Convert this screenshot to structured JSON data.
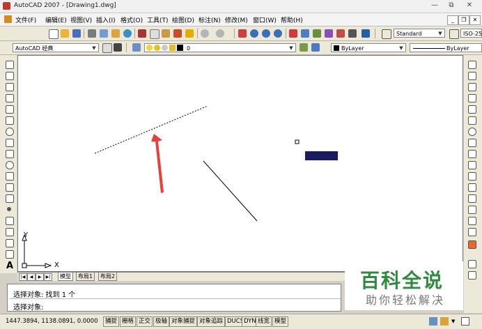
{
  "window": {
    "title": "AutoCAD 2007 - [Drawing1.dwg]",
    "controls": [
      "—",
      "⧉",
      "✕"
    ]
  },
  "menu": {
    "items": [
      "文件(F)",
      "编辑(E)",
      "视图(V)",
      "插入(I)",
      "格式(O)",
      "工具(T)",
      "绘图(D)",
      "标注(N)",
      "修改(M)",
      "窗口(W)",
      "帮助(H)"
    ],
    "doc_controls": [
      "_",
      "❐",
      "✕"
    ]
  },
  "toolbar": {
    "text_style": "Standard",
    "dim_style": "ISO-25",
    "workspace": "AutoCAD 经典",
    "layer": "0",
    "color": "ByLayer",
    "linetype": "ByLayer"
  },
  "colors": {
    "filled_rect": "#1a1a5e",
    "arrow": "#e8413b",
    "watermark_green": "#2e8b3e"
  },
  "drawing": {
    "axis_y": "Y",
    "axis_x": "X"
  },
  "layout_tabs": [
    "模型",
    "布局1",
    "布局2"
  ],
  "command": {
    "line1": "选择对象: 找到 1 个",
    "line2": "选择对象:"
  },
  "status": {
    "coords": "1447.3894, 1138.0891, 0.0000",
    "toggles": [
      "捕捉",
      "栅格",
      "正交",
      "极轴",
      "对象捕捉",
      "对象追踪",
      "DUCS",
      "DYN",
      "线宽",
      "模型"
    ]
  },
  "watermark": {
    "title": "百科全说",
    "subtitle": "助你轻松解决"
  }
}
